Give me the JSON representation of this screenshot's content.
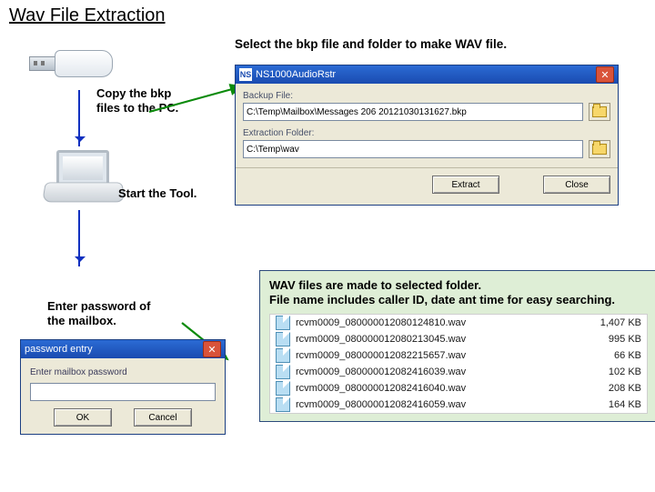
{
  "title": "Wav File Extraction",
  "top_instruction": "Select the bkp file and folder to make WAV file.",
  "copy_text_line1": "Copy the bkp",
  "copy_text_line2": "files to the PC.",
  "start_tool_text": "Start the Tool.",
  "enter_pw_line1": "Enter password of",
  "enter_pw_line2": "the mailbox.",
  "dialog": {
    "title": "NS1000AudioRstr",
    "backup_label": "Backup File:",
    "backup_value": "C:\\Temp\\Mailbox\\Messages 206 20121030131627.bkp",
    "extract_label": "Extraction Folder:",
    "extract_value": "C:\\Temp\\wav",
    "extract_btn": "Extract",
    "close_btn": "Close"
  },
  "pw_dialog": {
    "title": "password entry",
    "prompt": "Enter mailbox password",
    "value": "",
    "ok": "OK",
    "cancel": "Cancel"
  },
  "wavbox": {
    "line1": "WAV files are made to selected folder.",
    "line2": "File name includes caller ID, date ant time for easy searching.",
    "files": [
      {
        "name": "rcvm0009_080000012080124810.wav",
        "size": "1,407 KB"
      },
      {
        "name": "rcvm0009_080000012080213045.wav",
        "size": "995 KB"
      },
      {
        "name": "rcvm0009_080000012082215657.wav",
        "size": "66 KB"
      },
      {
        "name": "rcvm0009_080000012082416039.wav",
        "size": "102 KB"
      },
      {
        "name": "rcvm0009_080000012082416040.wav",
        "size": "208 KB"
      },
      {
        "name": "rcvm0009_080000012082416059.wav",
        "size": "164 KB"
      }
    ]
  }
}
